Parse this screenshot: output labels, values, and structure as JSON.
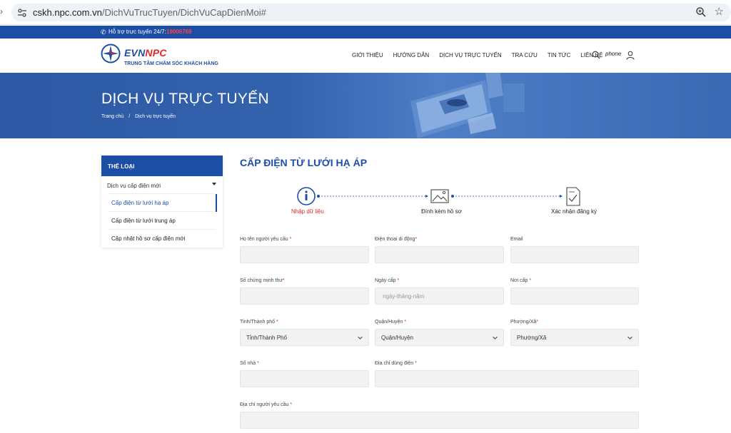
{
  "browser": {
    "url_domain": "cskh.npc.com.vn",
    "url_path": "/DichVuTrucTuyen/DichVuCapDienMoi#"
  },
  "topbar": {
    "support_label": "Hỗ trợ trực tuyến 24/7:",
    "hotline": "19006769"
  },
  "header": {
    "logo_text_blue": "EVN",
    "logo_text_red": "NPC",
    "logo_subtitle": "TRUNG TÂM CHĂM SÓC KHÁCH HÀNG",
    "nav": [
      {
        "label": "GIỚI THIỆU"
      },
      {
        "label": "HƯỚNG DẪN"
      },
      {
        "label": "DỊCH VỤ TRỰC TUYẾN"
      },
      {
        "label": "TRA CỨU"
      },
      {
        "label": "TIN TỨC"
      },
      {
        "label": "LIÊN HỆ"
      }
    ],
    "phone_text": "phone"
  },
  "banner": {
    "title": "DỊCH VỤ TRỰC TUYẾN",
    "breadcrumb_home": "Trang chủ",
    "breadcrumb_sep": "/",
    "breadcrumb_current": "Dịch vụ trực tuyến"
  },
  "sidebar": {
    "heading": "THỂ LOẠI",
    "parent": "Dịch vụ cấp điện mới",
    "items": [
      {
        "label": "Cấp điện từ lưới hạ áp"
      },
      {
        "label": "Cấp điện từ lưới trung áp"
      },
      {
        "label": "Cập nhật hồ sơ cấp điện mới"
      }
    ]
  },
  "main": {
    "title": "CẤP ĐIỆN TỪ LƯỚI HẠ ÁP",
    "steps": [
      {
        "label": "Nhập dữ liệu"
      },
      {
        "label": "Đính kèm hồ sơ"
      },
      {
        "label": "Xác nhận đăng ký"
      }
    ],
    "colors": {
      "accent": "#1d4ea6",
      "active_step": "#e4262b"
    },
    "form": {
      "ho_ten": {
        "label": "Họ tên người yêu cầu",
        "req": "*"
      },
      "dien_thoai": {
        "label": "Điện thoại di động",
        "req": "*"
      },
      "email": {
        "label": "Email",
        "req": ""
      },
      "so_cmt": {
        "label": "Số chứng minh thư",
        "req": "*"
      },
      "ngay_cap": {
        "label": "Ngày cấp",
        "req": "*",
        "placeholder": "ngày-tháng-năm"
      },
      "noi_cap": {
        "label": "Nơi cấp",
        "req": "*"
      },
      "tinh": {
        "label": "Tỉnh/Thành phố",
        "req": "*",
        "value": "Tỉnh/Thành Phố"
      },
      "quan": {
        "label": "Quận/Huyện",
        "req": "*",
        "value": "Quận/Huyện"
      },
      "phuong": {
        "label": "Phường/Xã",
        "req": "*",
        "value": "Phường/Xã"
      },
      "so_nha": {
        "label": "Số nhà",
        "req": "*"
      },
      "dia_chi_dung_dien": {
        "label": "Địa chỉ dùng điện",
        "req": "*"
      },
      "dia_chi_nguoi_yc": {
        "label": "Địa chỉ người yêu cầu",
        "req": "*"
      }
    }
  }
}
